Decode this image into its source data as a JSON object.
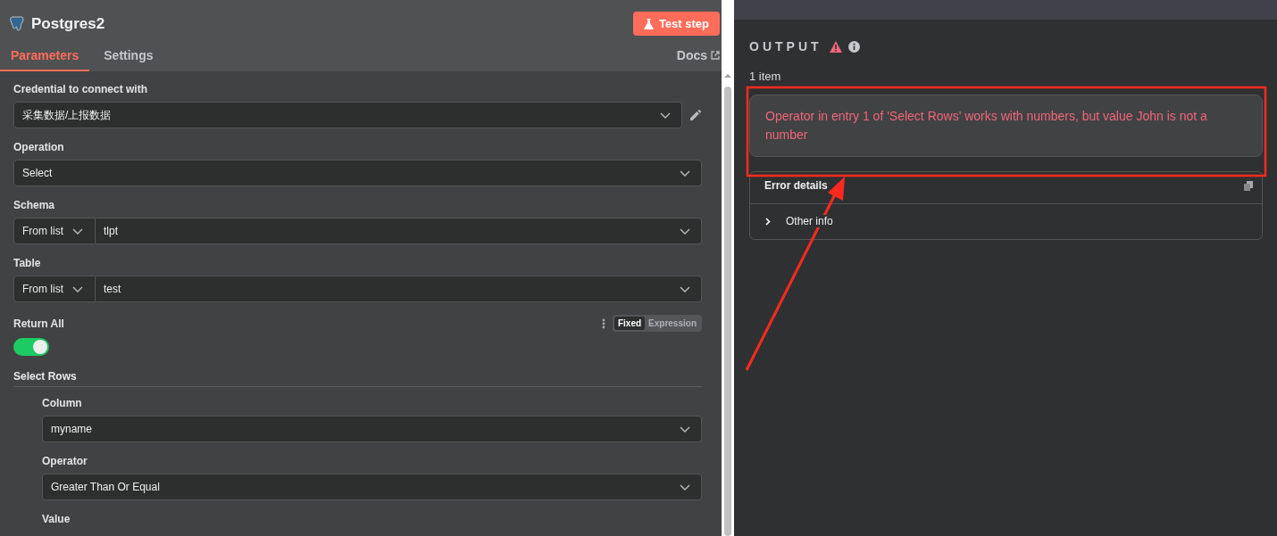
{
  "node": {
    "title": "Postgres2",
    "test_button": "Test step"
  },
  "tabs": [
    {
      "label": "Parameters",
      "selected": true
    },
    {
      "label": "Settings",
      "selected": false
    }
  ],
  "docs_link": "Docs",
  "fields": [
    {
      "kind": "credential",
      "label": "Credential to connect with",
      "value": "采集数据/上报数据"
    },
    {
      "kind": "select",
      "label": "Operation",
      "value": "Select"
    },
    {
      "kind": "list",
      "label": "Schema",
      "mode": "From list",
      "value": "tlpt"
    },
    {
      "kind": "list",
      "label": "Table",
      "mode": "From list",
      "value": "test"
    },
    {
      "kind": "toggle",
      "label": "Return All",
      "on": true,
      "modes": [
        {
          "label": "Fixed",
          "selected": true
        },
        {
          "label": "Expression",
          "selected": false
        }
      ]
    },
    {
      "kind": "section",
      "label": "Select Rows"
    }
  ],
  "select_rows": [
    {
      "kind": "select",
      "label": "Column",
      "value": "myname"
    },
    {
      "kind": "select",
      "label": "Operator",
      "value": "Greater Than Or Equal"
    },
    {
      "kind": "label",
      "label": "Value"
    }
  ],
  "output": {
    "title": "OUTPUT",
    "item_count": "1 item",
    "error_message": "Operator in entry 1 of 'Select Rows' works with numbers, but value John is not a number",
    "details": {
      "title": "Error details",
      "rows": [
        {
          "label": "Other info",
          "expanded": false
        }
      ]
    }
  }
}
